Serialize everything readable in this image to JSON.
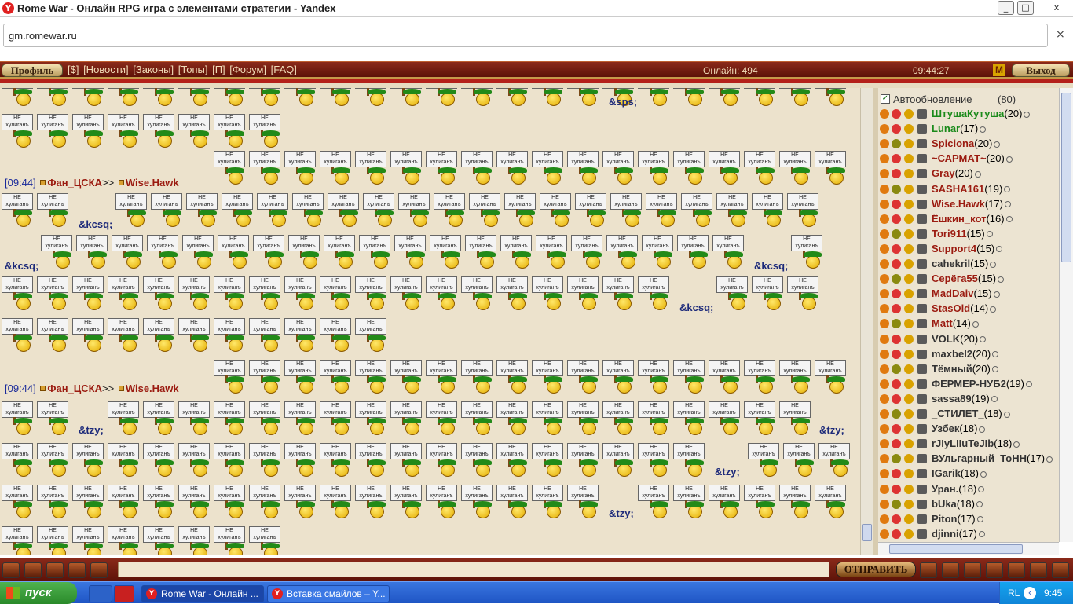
{
  "window": {
    "title": "Rome War - Онлайн RPG игра с элементами стратегии - Yandex",
    "logo_letter": "Y",
    "controls": {
      "minimize": "_",
      "maximize": "□",
      "close": "x"
    }
  },
  "address_bar": {
    "url": "gm.romewar.ru",
    "clear_glyph": "×"
  },
  "menu": {
    "profile_button": "Профиль",
    "links": "[$] [Новости] [Законы] [Топы] [П] [Форум] [FAQ]",
    "online_text": "Онлайн: 494",
    "time": "09:44:27",
    "m_badge": "M",
    "exit_button": "Выход"
  },
  "chat": {
    "sign_text": "НЕ хулиганъ",
    "messages": [
      {
        "time": "[09:44]",
        "from": "Фан_ЦСКА",
        "arrow": ">>",
        "to": "Wise.Hawk"
      },
      {
        "time": "[09:44]",
        "from": "Фан_ЦСКА",
        "arrow": ">>",
        "to": "Wise.Hawk"
      }
    ],
    "tokens": {
      "sps": "&sps;",
      "kcsq": "&kcsq;",
      "tzy": "&tzy;"
    }
  },
  "online_panel": {
    "autoupdate_label": "Автообновление",
    "autoupdate_checked": "✓",
    "count": "(80)",
    "users": [
      {
        "name": "ШтушаКутуша",
        "level": "(20)",
        "color": "#1a8a1a"
      },
      {
        "name": "Lunar",
        "level": "(17)",
        "color": "#1a8a1a"
      },
      {
        "name": "Spiciona",
        "level": "(20)",
        "color": "#9b1b10"
      },
      {
        "name": "~САРМАТ~",
        "level": "(20)",
        "color": "#9b1b10"
      },
      {
        "name": "Gray",
        "level": "(20)",
        "color": "#9b1b10"
      },
      {
        "name": "SASHA161",
        "level": "(19)",
        "color": "#9b1b10"
      },
      {
        "name": "Wise.Hawk",
        "level": "(17)",
        "color": "#9b1b10"
      },
      {
        "name": "Ёшкин_кот",
        "level": "(16)",
        "color": "#9b1b10"
      },
      {
        "name": "Tori911",
        "level": "(15)",
        "color": "#9b1b10"
      },
      {
        "name": "Support4",
        "level": "(15)",
        "color": "#9b1b10"
      },
      {
        "name": "cahekril",
        "level": "(15)",
        "color": "#333333"
      },
      {
        "name": "Серёга55",
        "level": "(15)",
        "color": "#9b1b10"
      },
      {
        "name": "MadDaiv",
        "level": "(15)",
        "color": "#9b1b10"
      },
      {
        "name": "StasOld",
        "level": "(14)",
        "color": "#9b1b10"
      },
      {
        "name": "Matt",
        "level": "(14)",
        "color": "#9b1b10"
      },
      {
        "name": "VOLK",
        "level": "(20)",
        "color": "#333333"
      },
      {
        "name": "maxbel2",
        "level": "(20)",
        "color": "#333333"
      },
      {
        "name": "Тёмный",
        "level": "(20)",
        "color": "#333333"
      },
      {
        "name": "ФЕРМЕР-НУБ2",
        "level": "(19)",
        "color": "#333333"
      },
      {
        "name": "sassa89",
        "level": "(19)",
        "color": "#333333"
      },
      {
        "name": "_СТИЛЕТ_",
        "level": "(18)",
        "color": "#333333"
      },
      {
        "name": "Узбек",
        "level": "(18)",
        "color": "#333333"
      },
      {
        "name": "rJIyLIIuTeJIb",
        "level": "(18)",
        "color": "#333333"
      },
      {
        "name": "ВУльгарный_ТоНН",
        "level": "(17)",
        "color": "#333333"
      },
      {
        "name": "IGarik",
        "level": "(18)",
        "color": "#333333"
      },
      {
        "name": "Уран.",
        "level": "(18)",
        "color": "#333333"
      },
      {
        "name": "bUka",
        "level": "(18)",
        "color": "#333333"
      },
      {
        "name": "Piton",
        "level": "(17)",
        "color": "#333333"
      },
      {
        "name": "djinni",
        "level": "(17)",
        "color": "#333333"
      }
    ]
  },
  "bottom_bar": {
    "send_button": "ОТПРАВИТЬ",
    "message_value": ""
  },
  "taskbar": {
    "start_label": "пуск",
    "apps": [
      "Rome War - Онлайн ...",
      "Вставка смайлов – Y..."
    ],
    "lang": "RL",
    "back_glyph": "‹",
    "clock": "9:45"
  },
  "colors": {
    "accent_red": "#8b2a1a",
    "chat_bg": "#ece2cc",
    "taskbar_blue": "#1f55c4"
  }
}
